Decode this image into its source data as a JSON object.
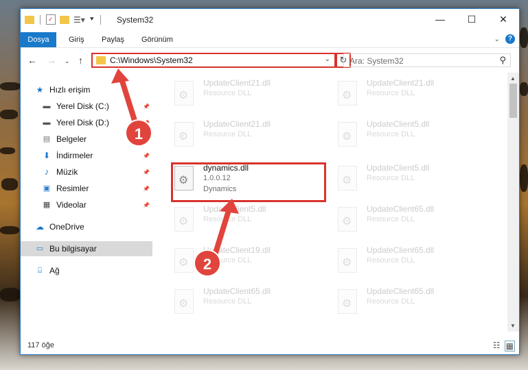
{
  "window": {
    "title": "System32"
  },
  "ribbon": {
    "tabs": [
      "Dosya",
      "Giriş",
      "Paylaş",
      "Görünüm"
    ]
  },
  "address": {
    "path": "C:\\Windows\\System32"
  },
  "search": {
    "placeholder": "Ara: System32"
  },
  "sidebar": {
    "items": [
      {
        "label": "Hızlı erişim",
        "icon": "star-icon",
        "pinned": false
      },
      {
        "label": "Yerel Disk (C:)",
        "icon": "drive-icon",
        "pinned": true
      },
      {
        "label": "Yerel Disk (D:)",
        "icon": "drive-icon",
        "pinned": true
      },
      {
        "label": "Belgeler",
        "icon": "documents-icon",
        "pinned": true
      },
      {
        "label": "İndirmeler",
        "icon": "download-icon",
        "pinned": true
      },
      {
        "label": "Müzik",
        "icon": "music-icon",
        "pinned": true
      },
      {
        "label": "Resimler",
        "icon": "pictures-icon",
        "pinned": true
      },
      {
        "label": "Videolar",
        "icon": "video-icon",
        "pinned": true
      },
      {
        "label": "OneDrive",
        "icon": "cloud-icon",
        "pinned": false
      },
      {
        "label": "Bu bilgisayar",
        "icon": "computer-icon",
        "pinned": false
      },
      {
        "label": "Ağ",
        "icon": "network-icon",
        "pinned": false
      }
    ]
  },
  "files": {
    "left": [
      {
        "name": "UpdateClient21.dll",
        "ver": "Resource DLL",
        "desc": ""
      },
      {
        "name": "UpdateClient21.dll",
        "ver": "Resource DLL",
        "desc": ""
      },
      {
        "name": "dynamics.dll",
        "ver": "1.0.0.12",
        "desc": "Dynamics"
      },
      {
        "name": "UpdateClient5.dll",
        "ver": "Resource DLL",
        "desc": ""
      },
      {
        "name": "UpdateClient19.dll",
        "ver": "Resource DLL",
        "desc": ""
      },
      {
        "name": "UpdateClient65.dll",
        "ver": "Resource DLL",
        "desc": ""
      }
    ],
    "right": [
      {
        "name": "UpdateClient21.dll",
        "ver": "Resource DLL",
        "desc": ""
      },
      {
        "name": "UpdateClient5.dll",
        "ver": "Resource DLL",
        "desc": ""
      },
      {
        "name": "UpdateClient5.dll",
        "ver": "Resource DLL",
        "desc": ""
      },
      {
        "name": "UpdateClient65.dll",
        "ver": "Resource DLL",
        "desc": ""
      },
      {
        "name": "UpdateClient65.dll",
        "ver": "Resource DLL",
        "desc": ""
      },
      {
        "name": "UpdateClient65.dll",
        "ver": "Resource DLL",
        "desc": ""
      }
    ]
  },
  "status": {
    "count": "117 öğe"
  },
  "annotations": {
    "step1": "1",
    "step2": "2"
  },
  "colors": {
    "accent": "#1979ca",
    "highlight": "#d8322a",
    "badge": "#e0443c"
  }
}
